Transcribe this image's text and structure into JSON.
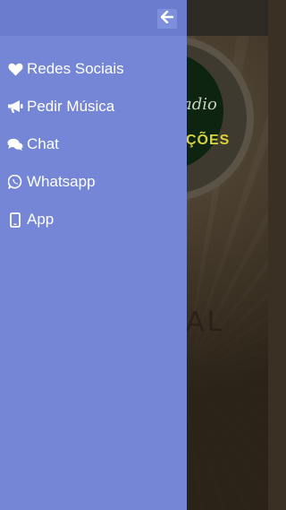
{
  "background": {
    "logo_script": "adio",
    "logo_bold": "ÇÕES",
    "word": "AL"
  },
  "drawer": {
    "back_icon": "arrow-left-icon",
    "items": [
      {
        "label": "Redes Sociais",
        "icon": "heart-icon"
      },
      {
        "label": "Pedir Música",
        "icon": "bullhorn-icon"
      },
      {
        "label": "Chat",
        "icon": "comments-icon"
      },
      {
        "label": "Whatsapp",
        "icon": "whatsapp-icon"
      },
      {
        "label": "App",
        "icon": "mobile-icon"
      }
    ]
  },
  "colors": {
    "drawer_bg": "#7486d5",
    "drawer_header": "#6b7ccf",
    "text": "#ffffff"
  }
}
